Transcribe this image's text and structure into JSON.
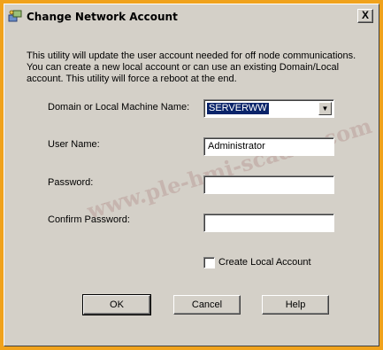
{
  "window": {
    "title": "Change Network Account",
    "close_glyph": "X",
    "app_icon": "network-account-icon"
  },
  "description": {
    "line1": "This utility will update the user account needed for off node communications.",
    "line2": "You can create a new  local account or can use an existing Domain/Local",
    "line3": "account. This utility will force a reboot at the end."
  },
  "form": {
    "domain_label": "Domain or Local Machine Name:",
    "domain_value": "SERVERWW",
    "username_label": "User Name:",
    "username_value": "Administrator",
    "password_label": "Password:",
    "password_value": "",
    "confirm_label": "Confirm Password:",
    "confirm_value": "",
    "create_local_label": "Create Local Account",
    "create_local_checked": false
  },
  "buttons": {
    "ok": "OK",
    "cancel": "Cancel",
    "help": "Help"
  },
  "watermark": "www.ple-hmi-scadas.com",
  "colors": {
    "frame": "#f0a21c",
    "dialog": "#d4d0c8",
    "selection": "#0a246a"
  }
}
